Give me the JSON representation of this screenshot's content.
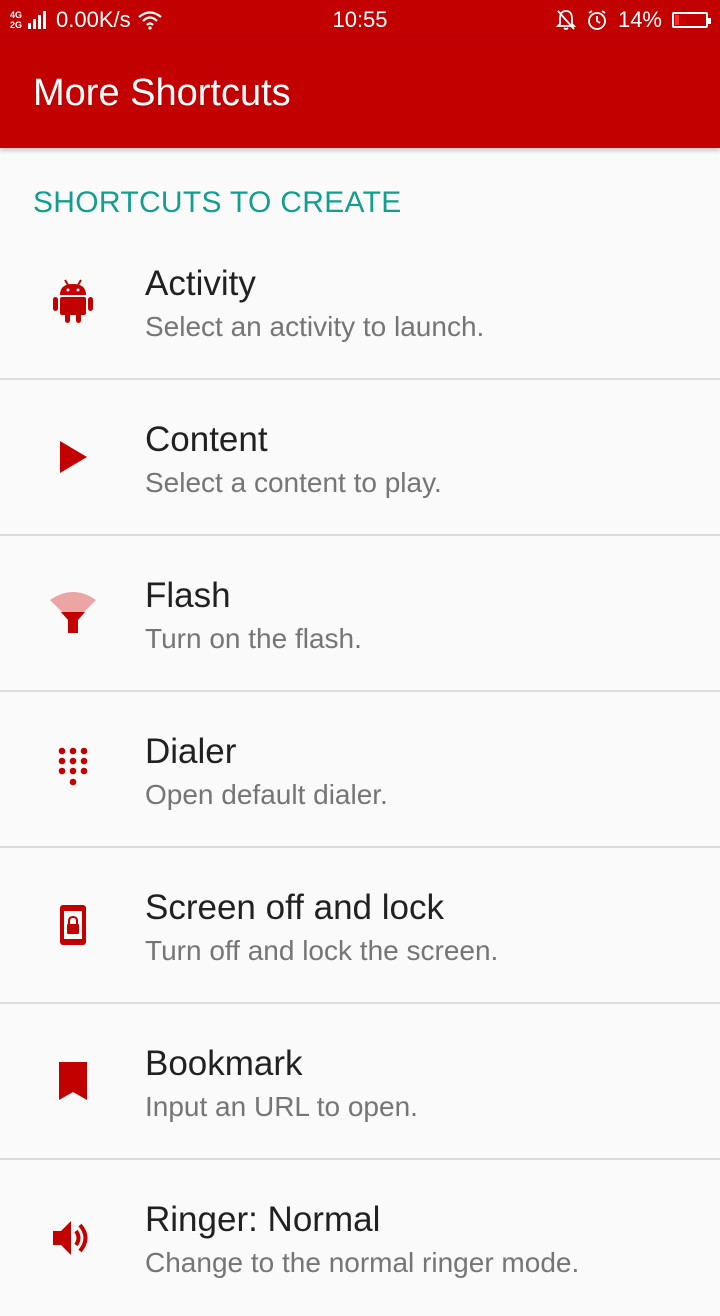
{
  "status_bar": {
    "network_type_top": "4G",
    "network_type_bottom": "2G",
    "speed": "0.00K/s",
    "time": "10:55",
    "battery": "14%",
    "battery_level": 0.14
  },
  "app_bar": {
    "title": "More Shortcuts"
  },
  "section": {
    "header": "SHORTCUTS TO CREATE"
  },
  "items": [
    {
      "title": "Activity",
      "subtitle": "Select an activity to launch.",
      "icon": "android-icon"
    },
    {
      "title": "Content",
      "subtitle": "Select a content to play.",
      "icon": "play-icon"
    },
    {
      "title": "Flash",
      "subtitle": "Turn on the flash.",
      "icon": "flashlight-icon"
    },
    {
      "title": "Dialer",
      "subtitle": "Open default dialer.",
      "icon": "dialpad-icon"
    },
    {
      "title": "Screen off and lock",
      "subtitle": "Turn off and lock the screen.",
      "icon": "screen-lock-icon"
    },
    {
      "title": "Bookmark",
      "subtitle": "Input an URL to open.",
      "icon": "bookmark-icon"
    },
    {
      "title": "Ringer: Normal",
      "subtitle": "Change to the normal ringer mode.",
      "icon": "volume-icon"
    }
  ],
  "colors": {
    "primary": "#c20000",
    "accent": "#139e8f",
    "icon": "#c20000"
  }
}
